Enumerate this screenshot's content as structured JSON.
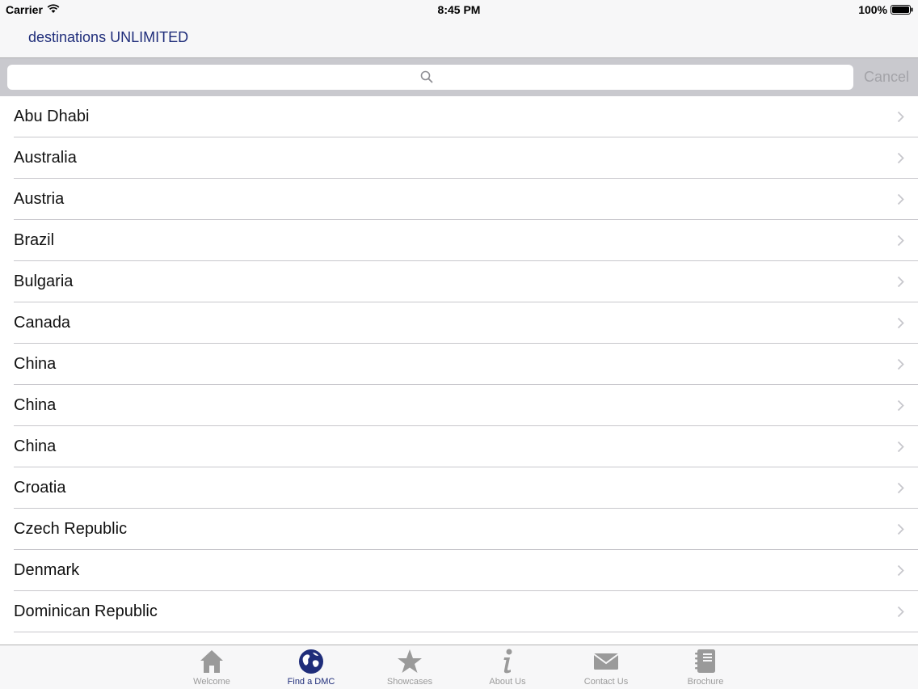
{
  "status_bar": {
    "carrier": "Carrier",
    "time": "8:45 PM",
    "battery": "100%"
  },
  "nav": {
    "title": "destinations UNLIMITED"
  },
  "search": {
    "placeholder": "",
    "value": "",
    "cancel_label": "Cancel"
  },
  "destinations": [
    "Abu Dhabi",
    "Australia",
    "Austria",
    "Brazil",
    "Bulgaria",
    "Canada",
    "China",
    "China",
    "China",
    "Croatia",
    "Czech Republic",
    "Denmark",
    "Dominican Republic"
  ],
  "tabs": [
    {
      "label": "Welcome",
      "icon": "home-icon",
      "active": false
    },
    {
      "label": "Find a DMC",
      "icon": "globe-icon",
      "active": true
    },
    {
      "label": "Showcases",
      "icon": "star-icon",
      "active": false
    },
    {
      "label": "About Us",
      "icon": "info-icon",
      "active": false
    },
    {
      "label": "Contact Us",
      "icon": "envelope-icon",
      "active": false
    },
    {
      "label": "Brochure",
      "icon": "brochure-icon",
      "active": false
    }
  ],
  "colors": {
    "brand": "#1f2d7a",
    "inactive": "#9a9a9a",
    "separator": "#c8c7cc",
    "search_bar": "#c9c9ce"
  }
}
